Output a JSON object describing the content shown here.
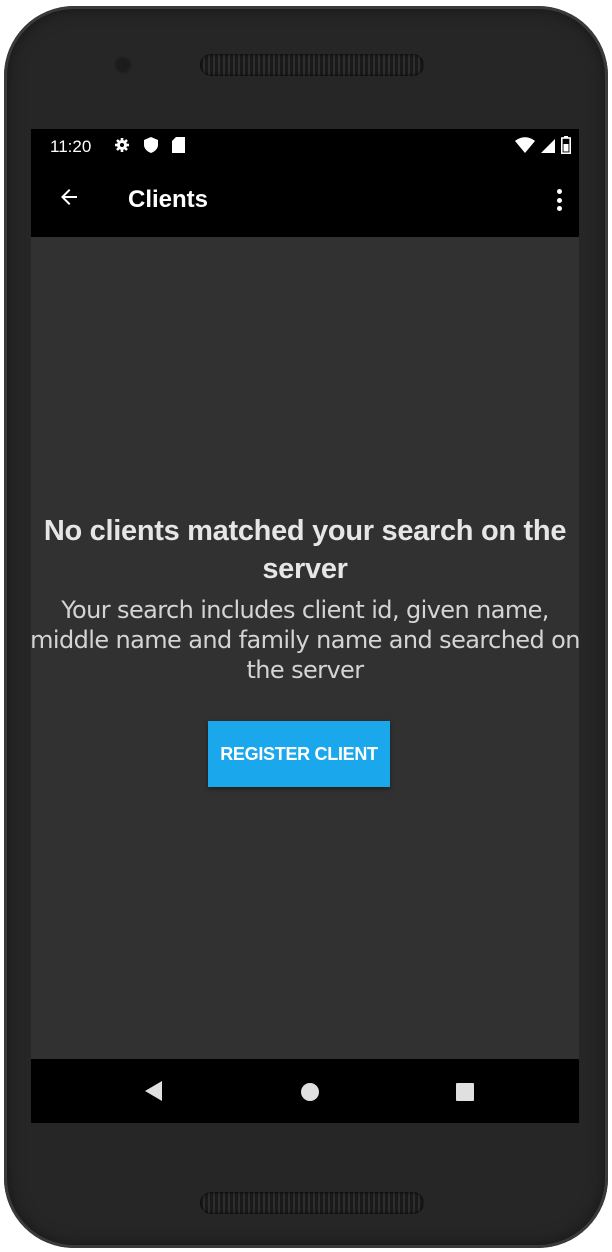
{
  "status_bar": {
    "time": "11:20",
    "left_icons": [
      "gear-icon",
      "shield-icon",
      "sd-card-icon"
    ],
    "right_icons": [
      "wifi-icon",
      "signal-icon",
      "battery-icon"
    ]
  },
  "toolbar": {
    "title": "Clients",
    "back_icon": "arrow-left-icon",
    "menu_icon": "more-vertical-icon"
  },
  "empty_state": {
    "title": "No clients matched your search on the server",
    "subtitle": "Your search includes client id, given name, middle name and family name and searched on the server",
    "button_label": "REGISTER CLIENT"
  },
  "nav_bar": {
    "icons": [
      "nav-back-icon",
      "nav-home-icon",
      "nav-recents-icon"
    ]
  },
  "colors": {
    "accent": "#1aa7ec",
    "background": "#313131",
    "bars": "#000000"
  }
}
